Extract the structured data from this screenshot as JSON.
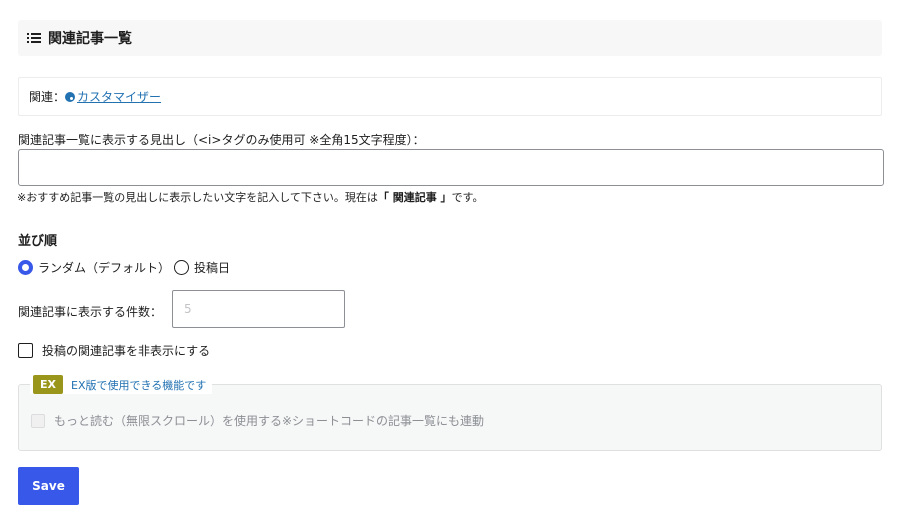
{
  "header": {
    "title": "関連記事一覧",
    "icon": "list-icon"
  },
  "related": {
    "label": "関連：",
    "link_text": "カスタマイザー",
    "link_icon": "palette-icon"
  },
  "heading_field": {
    "label": "関連記事一覧に表示する見出し（<i>タグのみ使用可 ※全角15文字程度）：",
    "value": "",
    "help_prefix": "※おすすめ記事一覧の見出しに表示したい文字を記入して下さい。現在は",
    "help_current": "「 関連記事 」",
    "help_suffix": "です。"
  },
  "sort": {
    "title": "並び順",
    "options": [
      {
        "label": "ランダム（デフォルト）",
        "checked": true
      },
      {
        "label": "投稿日",
        "checked": false
      }
    ]
  },
  "count": {
    "label": "関連記事に表示する件数：",
    "placeholder": "5"
  },
  "hide_related": {
    "label": "投稿の関連記事を非表示にする",
    "checked": false
  },
  "ex": {
    "badge": "EX",
    "title": "EX版で使用できる機能です",
    "option_label": "もっと読む（無限スクロール）を使用する※ショートコードの記事一覧にも連動"
  },
  "save": {
    "label": "Save"
  },
  "colors": {
    "accent": "#3858e9",
    "ex_badge": "#9a961c",
    "link": "#2271b1"
  }
}
